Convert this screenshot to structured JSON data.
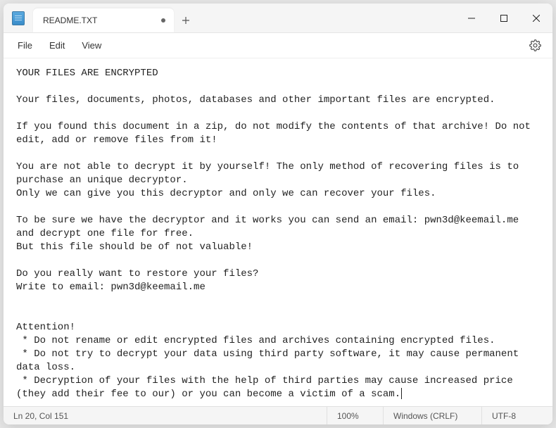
{
  "titlebar": {
    "tab_title": "README.TXT",
    "modified": true
  },
  "menubar": {
    "file": "File",
    "edit": "Edit",
    "view": "View"
  },
  "content": {
    "text": "YOUR FILES ARE ENCRYPTED\n\nYour files, documents, photos, databases and other important files are encrypted.\n\nIf you found this document in a zip, do not modify the contents of that archive! Do not edit, add or remove files from it!\n\nYou are not able to decrypt it by yourself! The only method of recovering files is to purchase an unique decryptor.\nOnly we can give you this decryptor and only we can recover your files.\n\nTo be sure we have the decryptor and it works you can send an email: pwn3d@keemail.me and decrypt one file for free.\nBut this file should be of not valuable!\n\nDo you really want to restore your files?\nWrite to email: pwn3d@keemail.me\n\n\nAttention!\n * Do not rename or edit encrypted files and archives containing encrypted files.\n * Do not try to decrypt your data using third party software, it may cause permanent data loss.\n * Decryption of your files with the help of third parties may cause increased price (they add their fee to our) or you can become a victim of a scam."
  },
  "statusbar": {
    "position": "Ln 20, Col 151",
    "zoom": "100%",
    "line_ending": "Windows (CRLF)",
    "encoding": "UTF-8"
  }
}
